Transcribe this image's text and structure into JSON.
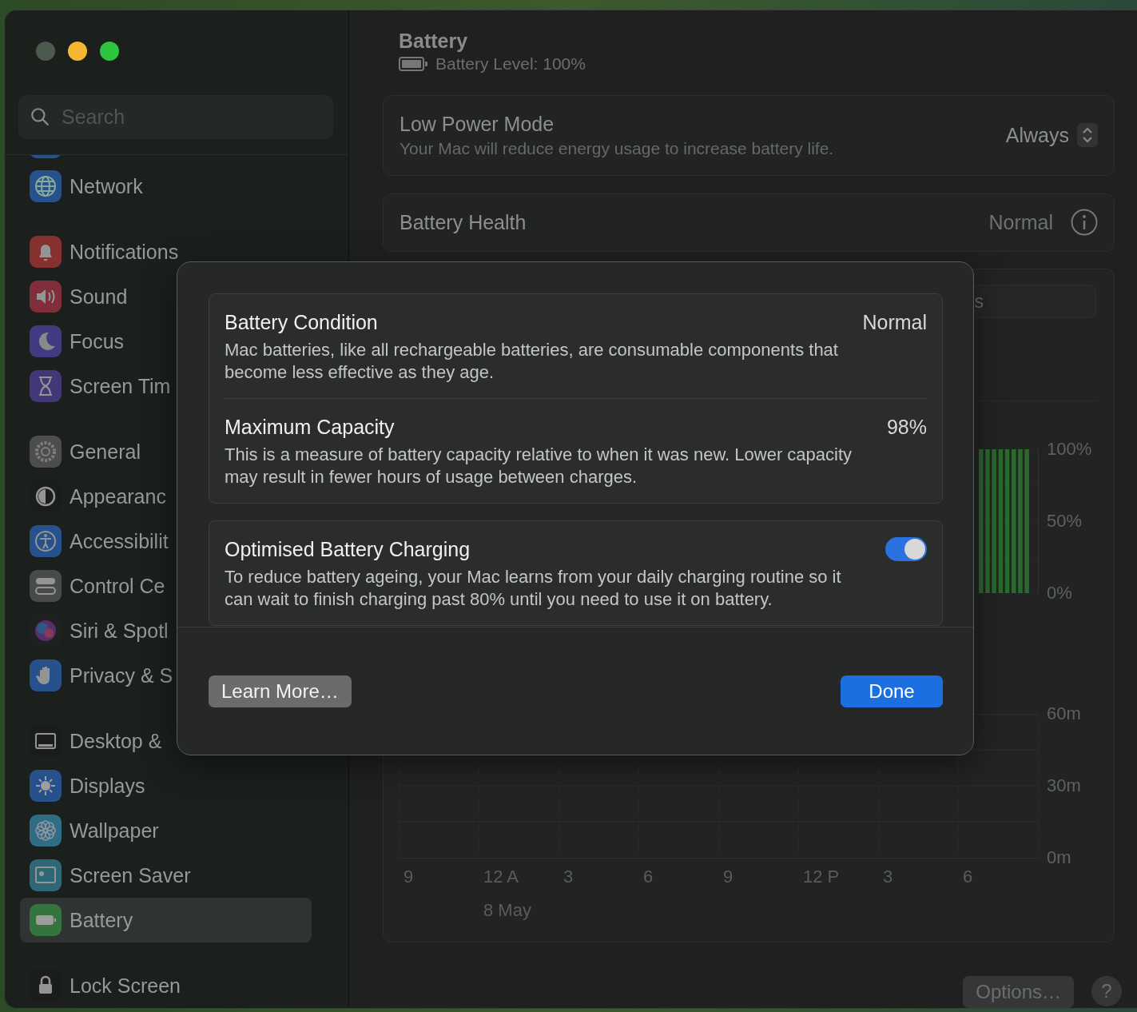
{
  "sidebar": {
    "search": {
      "placeholder": "Search"
    },
    "groups": [
      {
        "items": [
          {
            "label": "Network",
            "selected": false
          }
        ]
      },
      {
        "items": [
          {
            "label": "Notifications",
            "selected": false
          },
          {
            "label": "Sound",
            "selected": false
          },
          {
            "label": "Focus",
            "selected": false
          },
          {
            "label": "Screen Tim",
            "selected": false
          }
        ]
      },
      {
        "items": [
          {
            "label": "General",
            "selected": false
          },
          {
            "label": "Appearanc",
            "selected": false
          },
          {
            "label": "Accessibilit",
            "selected": false
          },
          {
            "label": "Control Ce",
            "selected": false
          },
          {
            "label": "Siri & Spotl",
            "selected": false
          },
          {
            "label": "Privacy & S",
            "selected": false
          }
        ]
      },
      {
        "items": [
          {
            "label": "Desktop &",
            "selected": false
          },
          {
            "label": "Displays",
            "selected": false
          },
          {
            "label": "Wallpaper",
            "selected": false
          },
          {
            "label": "Screen Saver",
            "selected": false
          },
          {
            "label": "Battery",
            "selected": true
          }
        ]
      },
      {
        "items": [
          {
            "label": "Lock Screen",
            "selected": false
          }
        ]
      }
    ]
  },
  "main": {
    "header": {
      "title": "Battery",
      "level_text": "Battery Level: 100%",
      "level": 1.0
    },
    "low_power": {
      "title": "Low Power Mode",
      "description": "Your Mac will reduce energy usage to increase battery life.",
      "value": "Always"
    },
    "health": {
      "title": "Battery Health",
      "value": "Normal"
    },
    "usage": {
      "segment_label": "s",
      "level_axis": [
        "100%",
        "50%",
        "0%"
      ],
      "screen_axis": [
        "60m",
        "30m",
        "0m"
      ],
      "x_ticks": [
        {
          "label": "9"
        },
        {
          "label": "12 A",
          "sublabel": "8 May"
        },
        {
          "label": "3"
        },
        {
          "label": "6"
        },
        {
          "label": "9"
        },
        {
          "label": "12 P"
        },
        {
          "label": "3"
        },
        {
          "label": "6"
        }
      ]
    },
    "options_button": "Options…",
    "help_button": "?"
  },
  "dialog": {
    "groups": [
      {
        "rows": [
          {
            "kind": "value",
            "title": "Battery Condition",
            "value": "Normal",
            "description": "Mac batteries, like all rechargeable batteries, are consumable components that become less effective as they age."
          },
          {
            "kind": "value",
            "title": "Maximum Capacity",
            "value": "98%",
            "description": "This is a measure of battery capacity relative to when it was new. Lower capacity may result in fewer hours of usage between charges."
          }
        ]
      },
      {
        "rows": [
          {
            "kind": "toggle",
            "title": "Optimised Battery Charging",
            "on": true,
            "description": "To reduce battery ageing, your Mac learns from your daily charging routine so it can wait to finish charging past 80% until you need to use it on battery."
          }
        ]
      }
    ],
    "buttons": [
      {
        "kind": "secondary",
        "label": "Learn More…"
      },
      {
        "kind": "primary",
        "label": "Done"
      }
    ]
  }
}
